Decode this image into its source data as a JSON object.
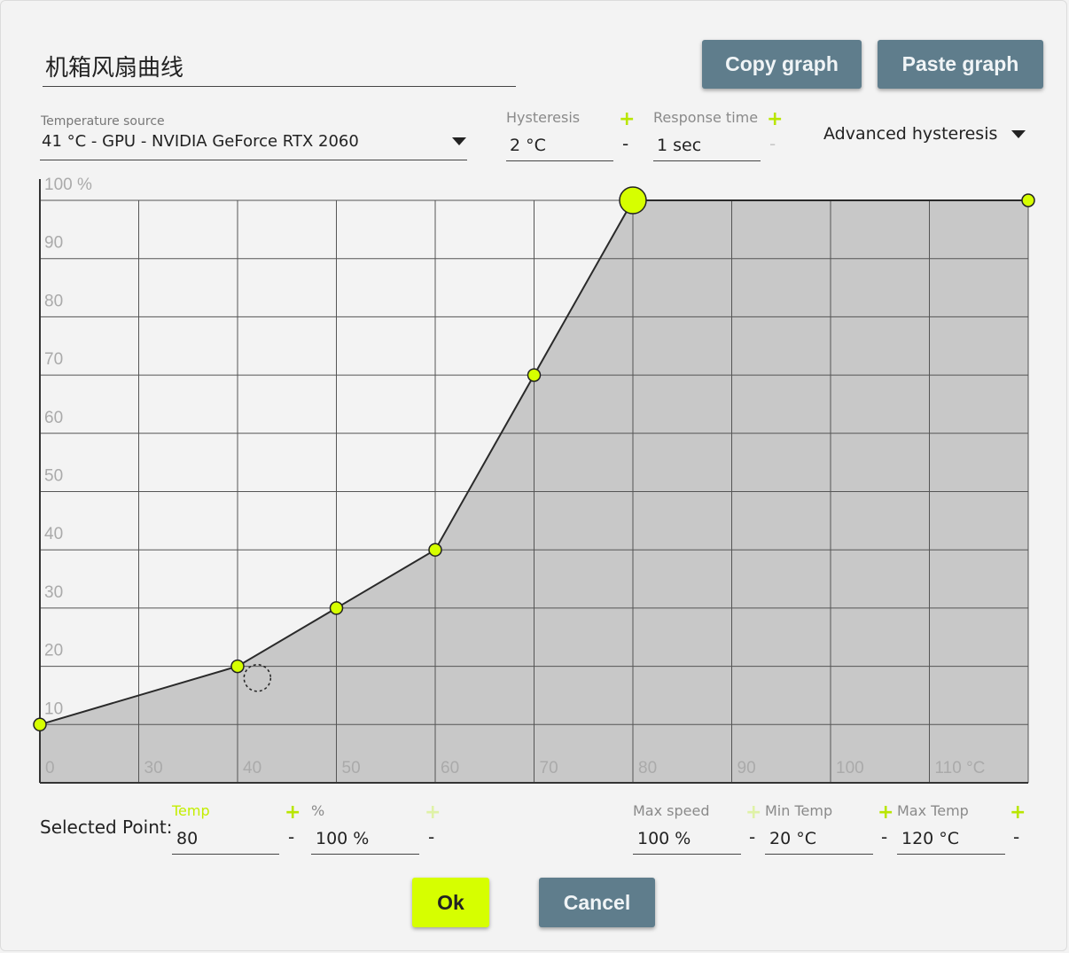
{
  "title": "机箱风扇曲线",
  "buttons": {
    "copy": "Copy graph",
    "paste": "Paste graph",
    "ok": "Ok",
    "cancel": "Cancel"
  },
  "temperature_source": {
    "label": "Temperature source",
    "value": "41 °C - GPU - NVIDIA GeForce RTX 2060"
  },
  "hysteresis": {
    "label": "Hysteresis",
    "value": "2 °C"
  },
  "response_time": {
    "label": "Response time",
    "value": "1 sec"
  },
  "advanced_hysteresis": {
    "label": "Advanced hysteresis"
  },
  "selected_point": {
    "label": "Selected Point:",
    "temp_label": "Temp",
    "temp_value": "80",
    "percent_label": "%",
    "percent_value": "100 %"
  },
  "limits": {
    "max_speed_label": "Max speed",
    "max_speed_value": "100 %",
    "min_temp_label": "Min Temp",
    "min_temp_value": "20 °C",
    "max_temp_label": "Max Temp",
    "max_temp_value": "120 °C"
  },
  "controls": {
    "plus": "+",
    "minus": "-"
  },
  "icons": {
    "dropdown": "caret-down-icon",
    "plus": "plus-icon",
    "minus": "minus-icon"
  },
  "colors": {
    "accent": "#d6ff00",
    "button": "#5f7d8c",
    "curve_fill": "#c8c8c8",
    "grid": "#555555",
    "axis_label": "#aaaaaa"
  },
  "chart_data": {
    "type": "area",
    "x_tick_labels": [
      "0",
      "30",
      "40",
      "50",
      "60",
      "70",
      "80",
      "90",
      "100",
      "110 °C"
    ],
    "y_tick_labels": [
      "10",
      "20",
      "30",
      "40",
      "50",
      "60",
      "70",
      "80",
      "90",
      "100 %"
    ],
    "xlim": [
      20,
      120
    ],
    "ylim": [
      0,
      100
    ],
    "grid": true,
    "points": [
      {
        "x": 20,
        "y": 10
      },
      {
        "x": 40,
        "y": 20
      },
      {
        "x": 50,
        "y": 30
      },
      {
        "x": 60,
        "y": 40
      },
      {
        "x": 70,
        "y": 70
      },
      {
        "x": 80,
        "y": 100
      },
      {
        "x": 120,
        "y": 100
      }
    ],
    "selected_point_index": 5,
    "cursor": {
      "x": 42,
      "y": 18
    }
  }
}
